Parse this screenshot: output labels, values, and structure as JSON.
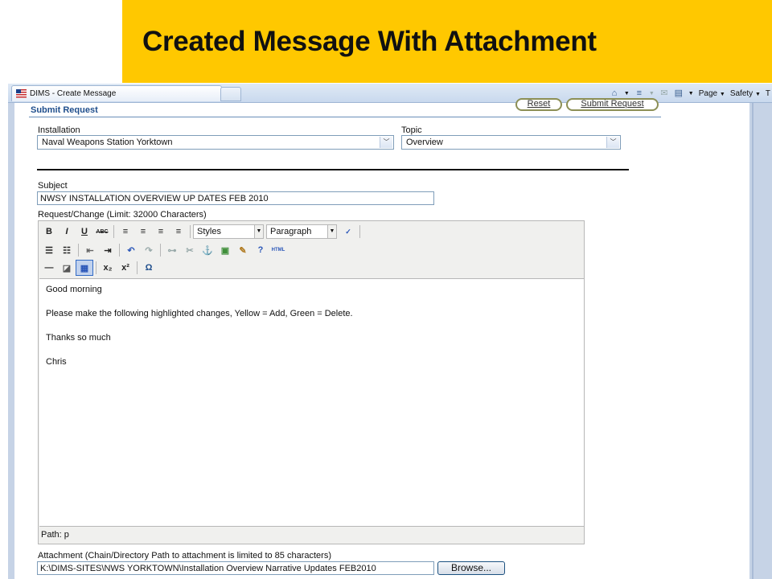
{
  "slide": {
    "title": "Created Message With Attachment"
  },
  "browser": {
    "tab_title": "DIMS - Create Message",
    "cmd": {
      "page": "Page",
      "safety": "Safety",
      "tools": "T"
    }
  },
  "form": {
    "section_title": "Submit Request",
    "reset_label": "Reset",
    "submit_label": "Submit Request",
    "installation": {
      "label": "Installation",
      "value": "Naval Weapons Station Yorktown"
    },
    "topic": {
      "label": "Topic",
      "value": "Overview"
    },
    "subject": {
      "label": "Subject",
      "value": "NWSY INSTALLATION OVERVIEW UP DATES FEB 2010"
    },
    "request_label": "Request/Change (Limit: 32000 Characters)",
    "editor": {
      "styles_value": "Styles",
      "format_value": "Paragraph",
      "paragraphs": [
        "Good morning",
        "Please make the following highlighted changes, Yellow = Add, Green = Delete.",
        "Thanks so much",
        "Chris"
      ],
      "path": "Path: p"
    },
    "attachment": {
      "label": "Attachment (Chain/Directory Path to attachment is limited to 85 characters)",
      "value": "K:\\DIMS-SITES\\NWS YORKTOWN\\Installation Overview Narrative Updates FEB2010",
      "browse_label": "Browse..."
    }
  },
  "colors": {
    "banner": "#ffc800",
    "section_title": "#1f4e8c"
  }
}
